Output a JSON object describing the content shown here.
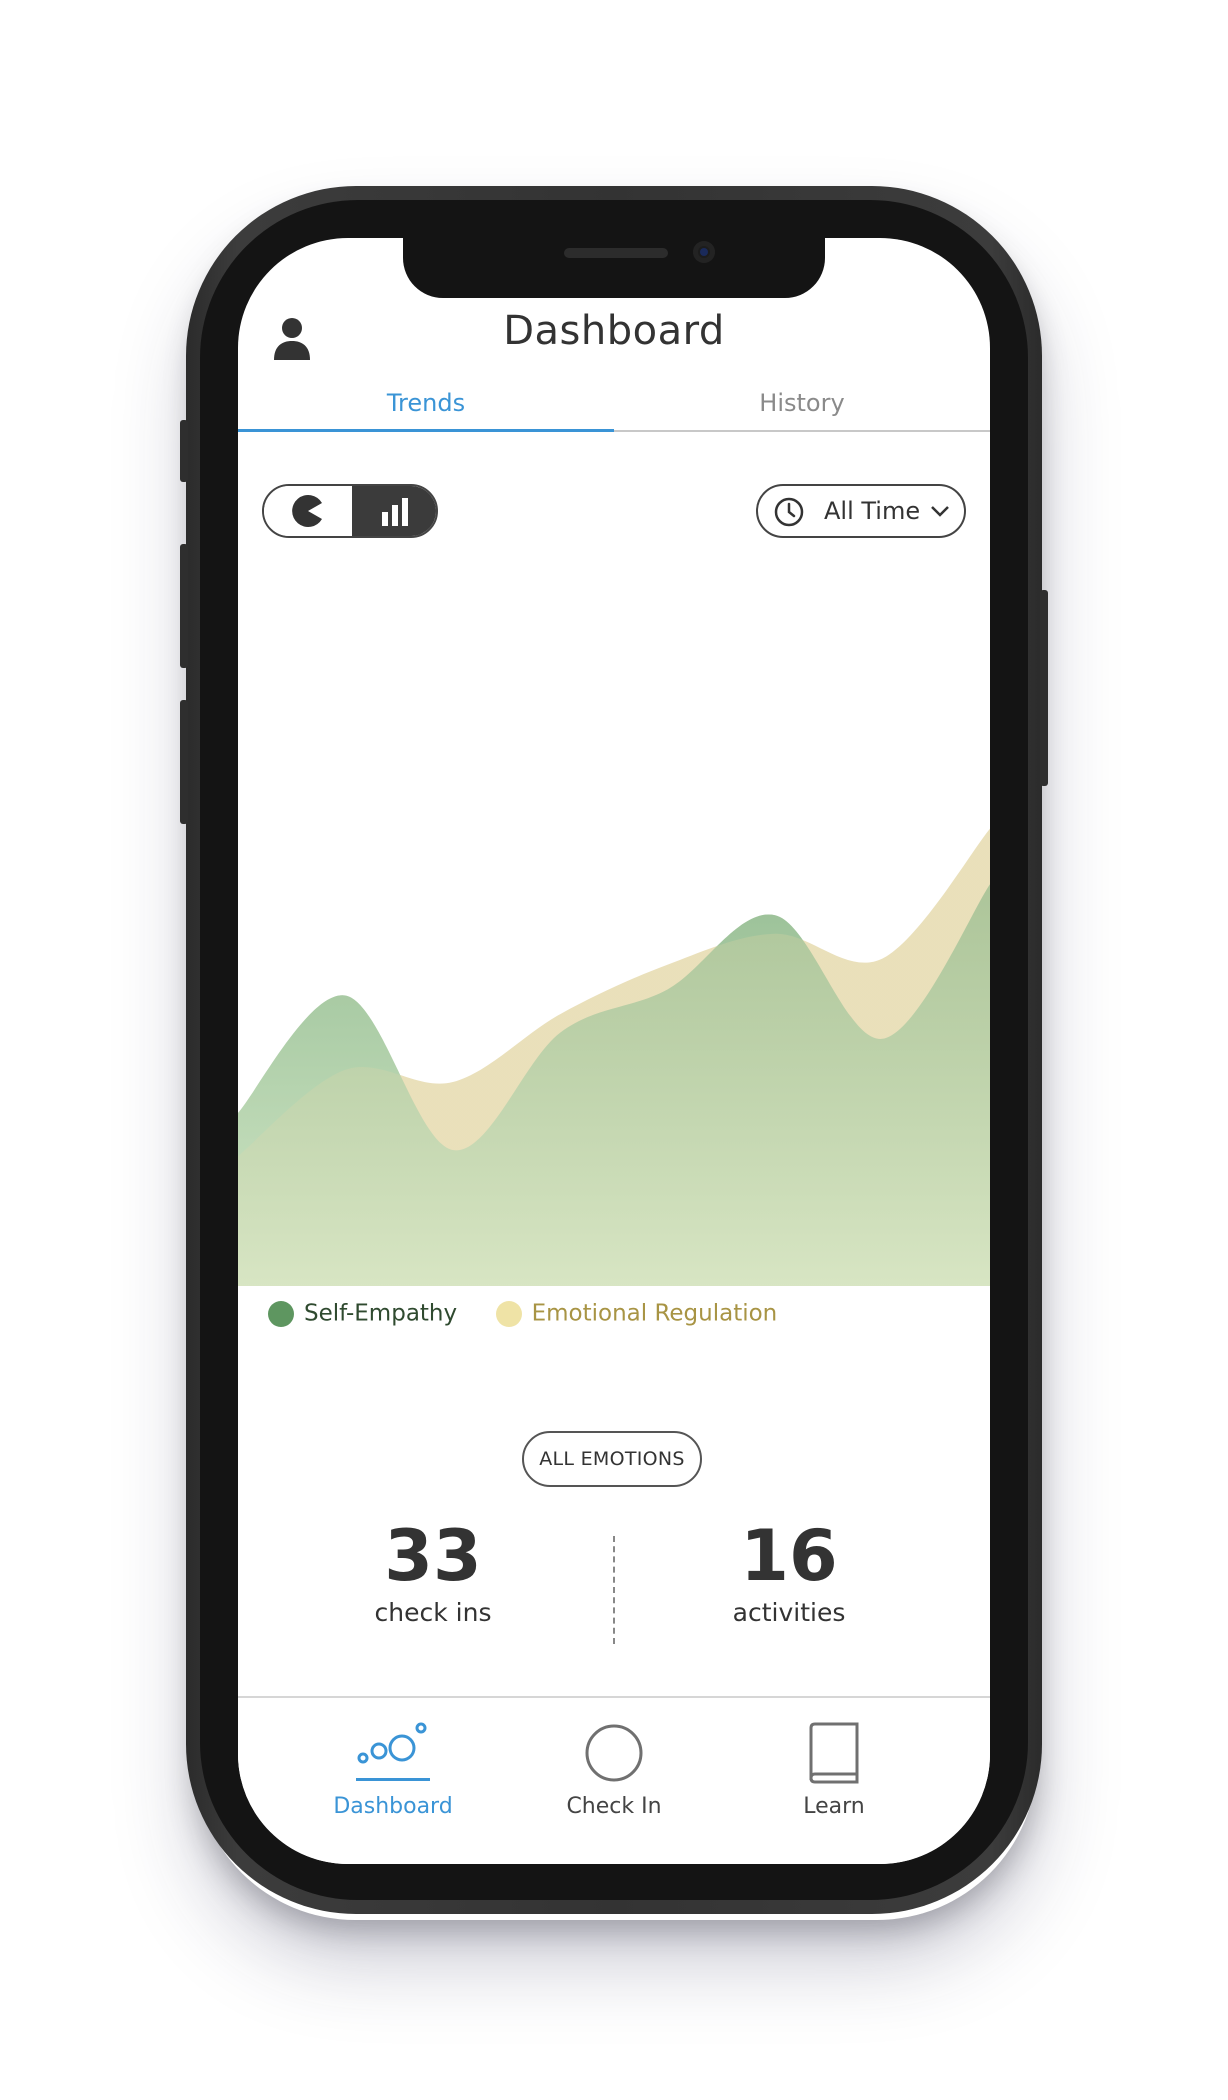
{
  "header": {
    "title": "Dashboard",
    "profile_icon": "user-icon"
  },
  "tabs": [
    {
      "label": "Trends",
      "active": true
    },
    {
      "label": "History",
      "active": false
    }
  ],
  "controls": {
    "view_toggle": {
      "options": [
        "pie-chart-icon",
        "bar-chart-icon"
      ],
      "selected": "bar-chart-icon"
    },
    "time_filter": {
      "label": "All Time",
      "icon": "clock-icon"
    }
  },
  "chart_data": {
    "type": "area",
    "x": [
      0,
      1,
      2,
      3,
      4,
      5,
      6,
      7
    ],
    "series": [
      {
        "name": "Self-Empathy",
        "color": "#5e9660",
        "values": [
          28,
          47,
          22,
          41,
          48,
          60,
          40,
          65
        ]
      },
      {
        "name": "Emotional Regulation",
        "color": "#e9e0b4",
        "values": [
          21,
          35,
          33,
          44,
          52,
          57,
          53,
          74
        ]
      }
    ],
    "grid": false,
    "legend": "bottom-left"
  },
  "legend": [
    {
      "label": "Self-Empathy",
      "dot_color": "#5e9660",
      "text_color": "#2f4a2f"
    },
    {
      "label": "Emotional Regulation",
      "dot_color": "#efe3a6",
      "text_color": "#a89444"
    }
  ],
  "filter_button": {
    "label": "ALL EMOTIONS"
  },
  "stats": {
    "checkins": {
      "value": "33",
      "label": "check ins"
    },
    "activities": {
      "value": "16",
      "label": "activities"
    }
  },
  "bottom_nav": [
    {
      "label": "Dashboard",
      "icon": "dashboard-bubbles-icon",
      "active": true,
      "color": "#3a94d6"
    },
    {
      "label": "Check In",
      "icon": "circle-icon",
      "active": false,
      "color": "#444444"
    },
    {
      "label": "Learn",
      "icon": "book-icon",
      "active": false,
      "color": "#444444"
    }
  ]
}
